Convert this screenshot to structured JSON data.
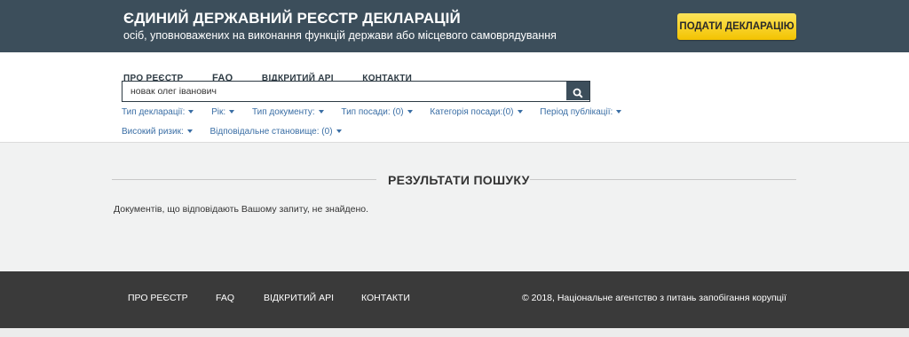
{
  "header": {
    "title": "ЄДИНИЙ ДЕРЖАВНИЙ РЕЄСТР ДЕКЛАРАЦІЙ",
    "subtitle": "осіб, уповноважених на виконання функцій держави або місцевого самоврядування",
    "submit_button": "ПОДАТИ ДЕКЛАРАЦІЮ"
  },
  "nav": {
    "items": [
      "ПРО РЕЄСТР",
      "FAQ",
      "ВІДКРИТИЙ API",
      "КОНТАКТИ"
    ]
  },
  "search": {
    "value": "новак олег іванович",
    "button_icon": "search-icon"
  },
  "filters": {
    "row1": [
      "Тип декларації:",
      "Рік:",
      "Тип документу:",
      "Тип посади: (0)",
      "Категорія посади:(0)",
      "Період публікації:"
    ],
    "row2": [
      "Високий ризик:",
      "Відповідальне становище: (0)"
    ]
  },
  "results": {
    "title": "РЕЗУЛЬТАТИ ПОШУКУ",
    "message": "Документів, що відповідають Вашому запиту, не знайдено."
  },
  "footer": {
    "links": [
      "ПРО РЕЄСТР",
      "FAQ",
      "ВІДКРИТИЙ API",
      "КОНТАКТИ"
    ],
    "copyright": "© 2018, Національне агентство з питань запобігання корупції"
  },
  "colors": {
    "header_bg": "#3c4e5b",
    "accent_button": "#f3c300",
    "link": "#3a6ea5",
    "footer_bg": "#3a3a3a"
  }
}
